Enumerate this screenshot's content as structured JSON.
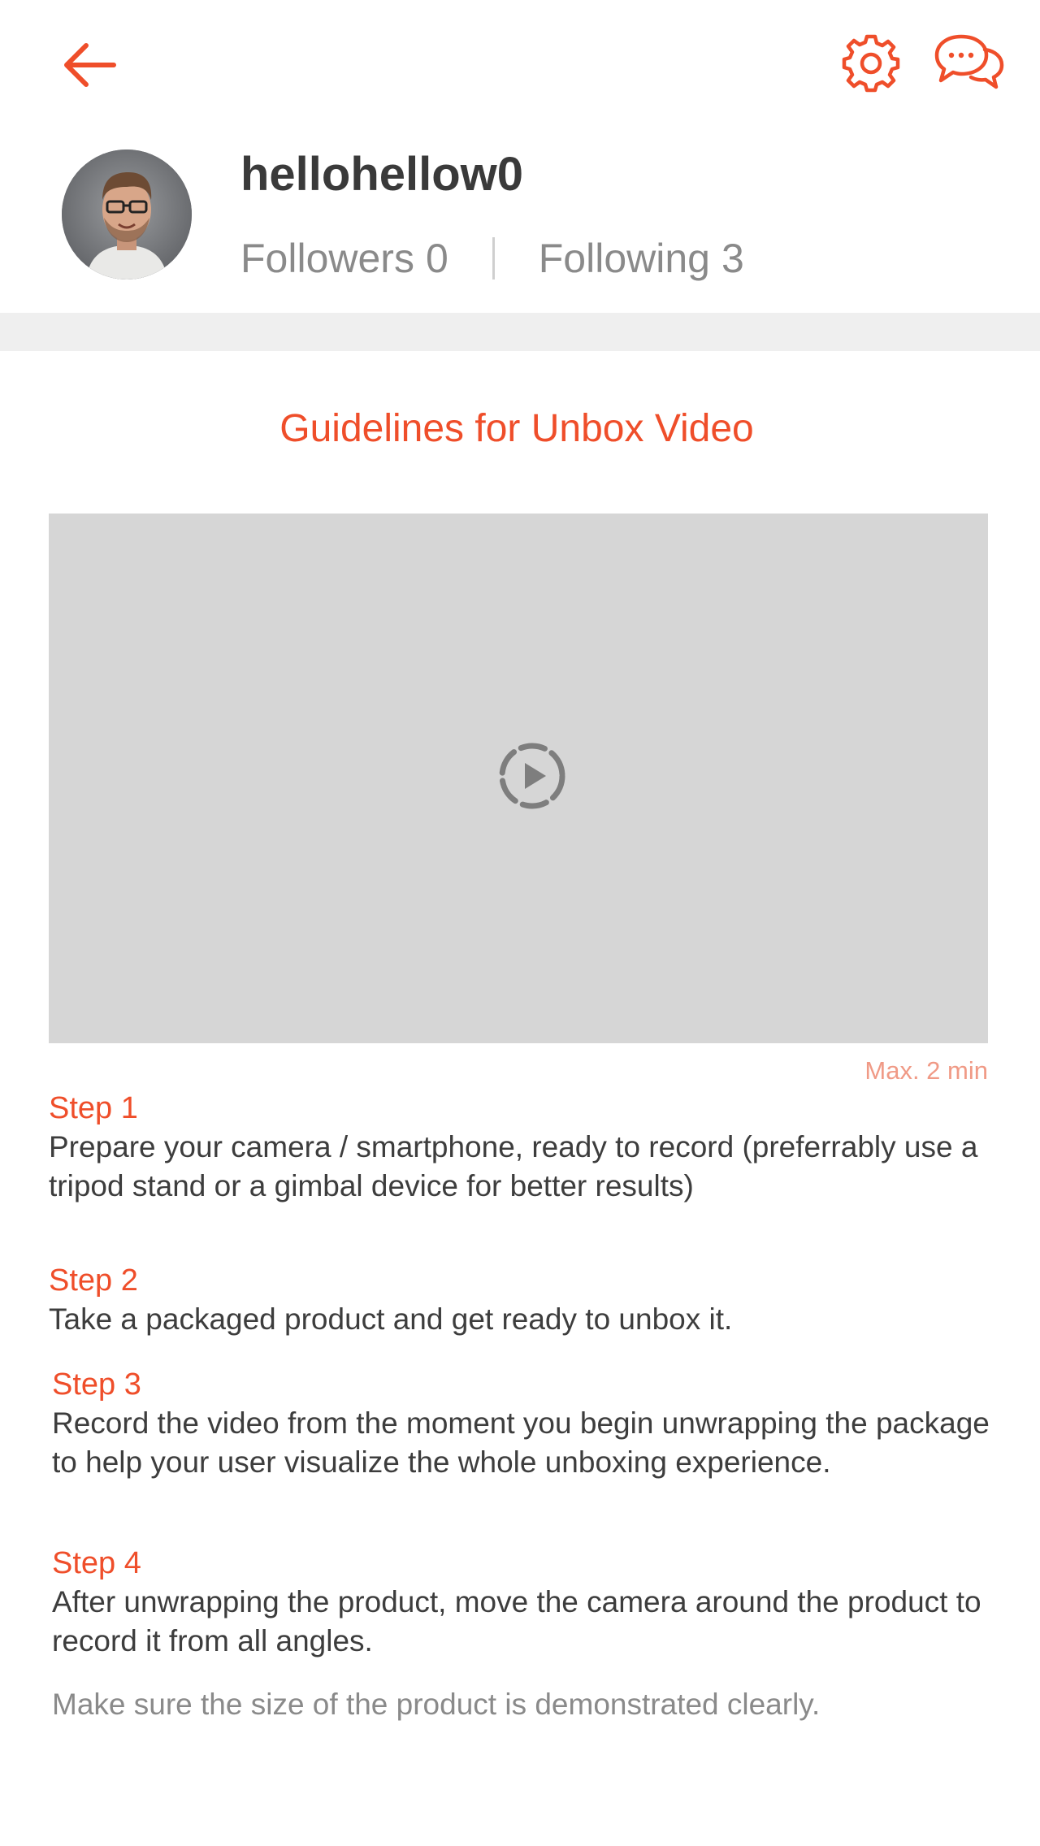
{
  "colors": {
    "accent": "#ef4e2a",
    "text_dark": "#3d3d3d",
    "text_muted": "#8a8a8a",
    "video_bg": "#d6d6d6",
    "divider_bg": "#efefef"
  },
  "topbar": {
    "back_icon": "arrow-left-icon",
    "settings_icon": "gear-icon",
    "chat_icon": "chat-bubbles-icon"
  },
  "profile": {
    "username": "hellohellow0",
    "followers_label": "Followers",
    "followers_count": "0",
    "following_label": "Following",
    "following_count": "3"
  },
  "guide": {
    "title": "Guidelines for Unbox Video",
    "video_icon": "play-circle-icon",
    "max_label": "Max. 2 min",
    "steps": [
      {
        "title": "Step 1",
        "text": "Prepare your camera / smartphone, ready to record (preferrably use a tripod stand or a gimbal device for better results)"
      },
      {
        "title": "Step 2",
        "text": "Take a packaged product and get ready to unbox it."
      },
      {
        "title": "Step 3",
        "text": "Record the video from the moment you begin unwrapping the package to help your user visualize the whole unboxing experience."
      },
      {
        "title": "Step 4",
        "text": "After unwrapping the product, move the camera around the product to record it from all angles."
      }
    ],
    "note": "Make sure the size of the product is demonstrated clearly."
  }
}
